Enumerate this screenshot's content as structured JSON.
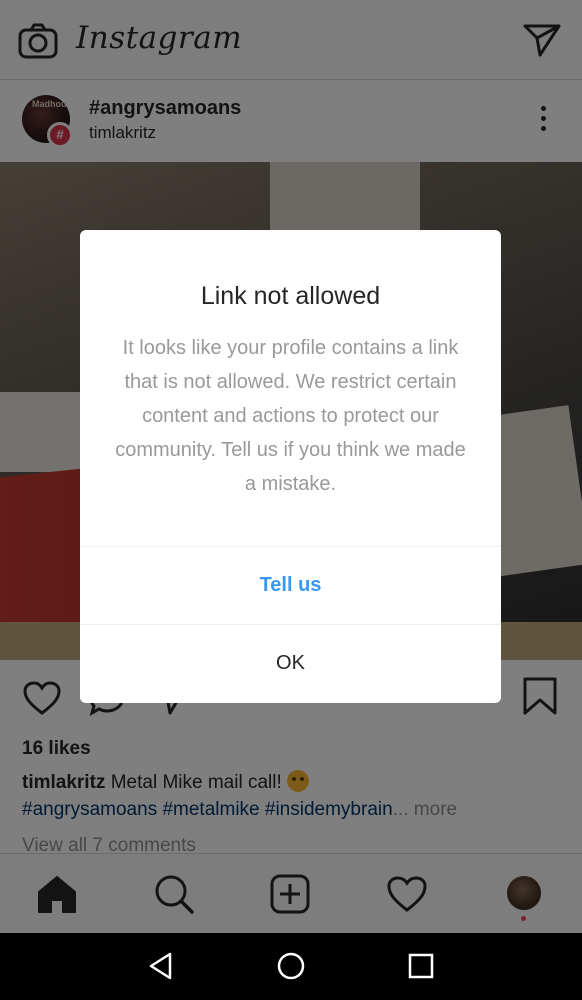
{
  "app": {
    "logo_text": "Instagram"
  },
  "post": {
    "title": "#angrysamoans",
    "subtitle": "timlakritz",
    "avatar_text": "Madhou",
    "badge": "#",
    "likes": "16 likes",
    "caption_user": "timlakritz",
    "caption_text": "Metal Mike mail call!",
    "hashtags": "#angrysamoans #metalmike #insidemybrain",
    "more_label": "... more",
    "view_all": "View all 7 comments"
  },
  "dialog": {
    "title": "Link not allowed",
    "body": "It looks like your profile contains a link that is not allowed. We restrict certain content and actions to protect our community. Tell us if you think we made a mistake.",
    "primary_button": "Tell us",
    "secondary_button": "OK"
  },
  "colors": {
    "link_blue": "#3897f0",
    "hashtag_blue": "#003569",
    "badge_red": "#d9344b",
    "notification_dot": "#ed4956"
  },
  "icons": {
    "top_left": "camera-icon",
    "top_right": "direct-message-icon",
    "post_actions": [
      "heart-icon",
      "comment-icon",
      "share-icon",
      "bookmark-icon"
    ],
    "bottom_nav": [
      "home-icon",
      "search-icon",
      "add-post-icon",
      "activity-heart-icon",
      "profile-avatar"
    ],
    "system_nav": [
      "back-icon",
      "home-circle-icon",
      "recents-icon"
    ]
  }
}
